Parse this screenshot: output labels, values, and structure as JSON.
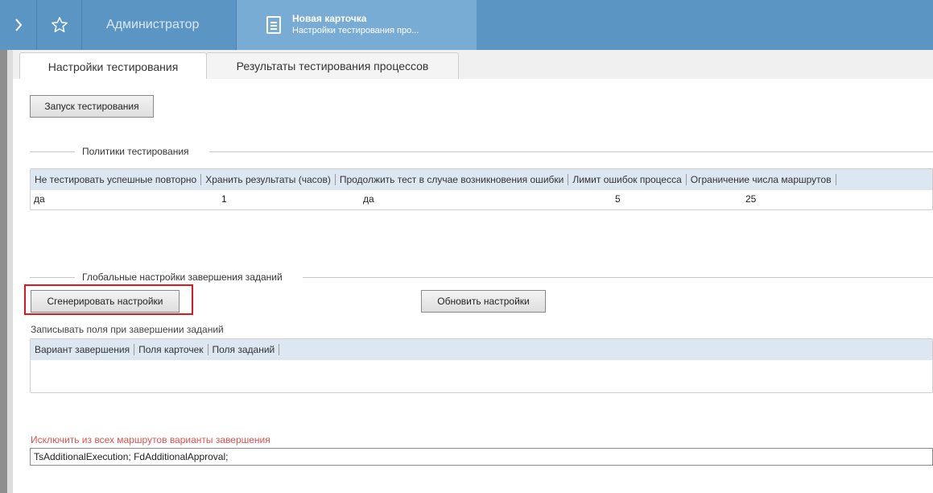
{
  "topbar": {
    "admin_label": "Администратор",
    "card_title": "Новая карточка",
    "card_subtitle": "Настройки тестирования про...",
    "bg_color": "#5b95c4",
    "active_tab_color": "#79acd5"
  },
  "tabs": [
    {
      "label": "Настройки тестирования",
      "active": true
    },
    {
      "label": "Результаты тестирования процессов",
      "active": false
    }
  ],
  "run_button": "Запуск тестирования",
  "policies": {
    "group_title": "Политики тестирования",
    "columns": [
      "Не тестировать успешные повторно",
      "Хранить результаты (часов)",
      "Продолжить тест в случае возникновения ошибки",
      "Лимит ошибок процесса",
      "Ограничение числа маршрутов"
    ],
    "row": [
      "да",
      "1",
      "да",
      "5",
      "25"
    ]
  },
  "global_settings": {
    "group_title": "Глобальные настройки завершения заданий",
    "generate_button": "Сгенерировать настройки",
    "refresh_button": "Обновить настройки",
    "record_fields_label": "Записывать поля при завершении заданий",
    "columns": [
      "Вариант завершения",
      "Поля карточек",
      "Поля заданий"
    ]
  },
  "exclude": {
    "label": "Исключить из всех маршрутов варианты завершения",
    "value": "TsAdditionalExecution; FdAdditionalApproval;",
    "label_color": "#d9534f"
  },
  "highlight_color": "#e3161b"
}
